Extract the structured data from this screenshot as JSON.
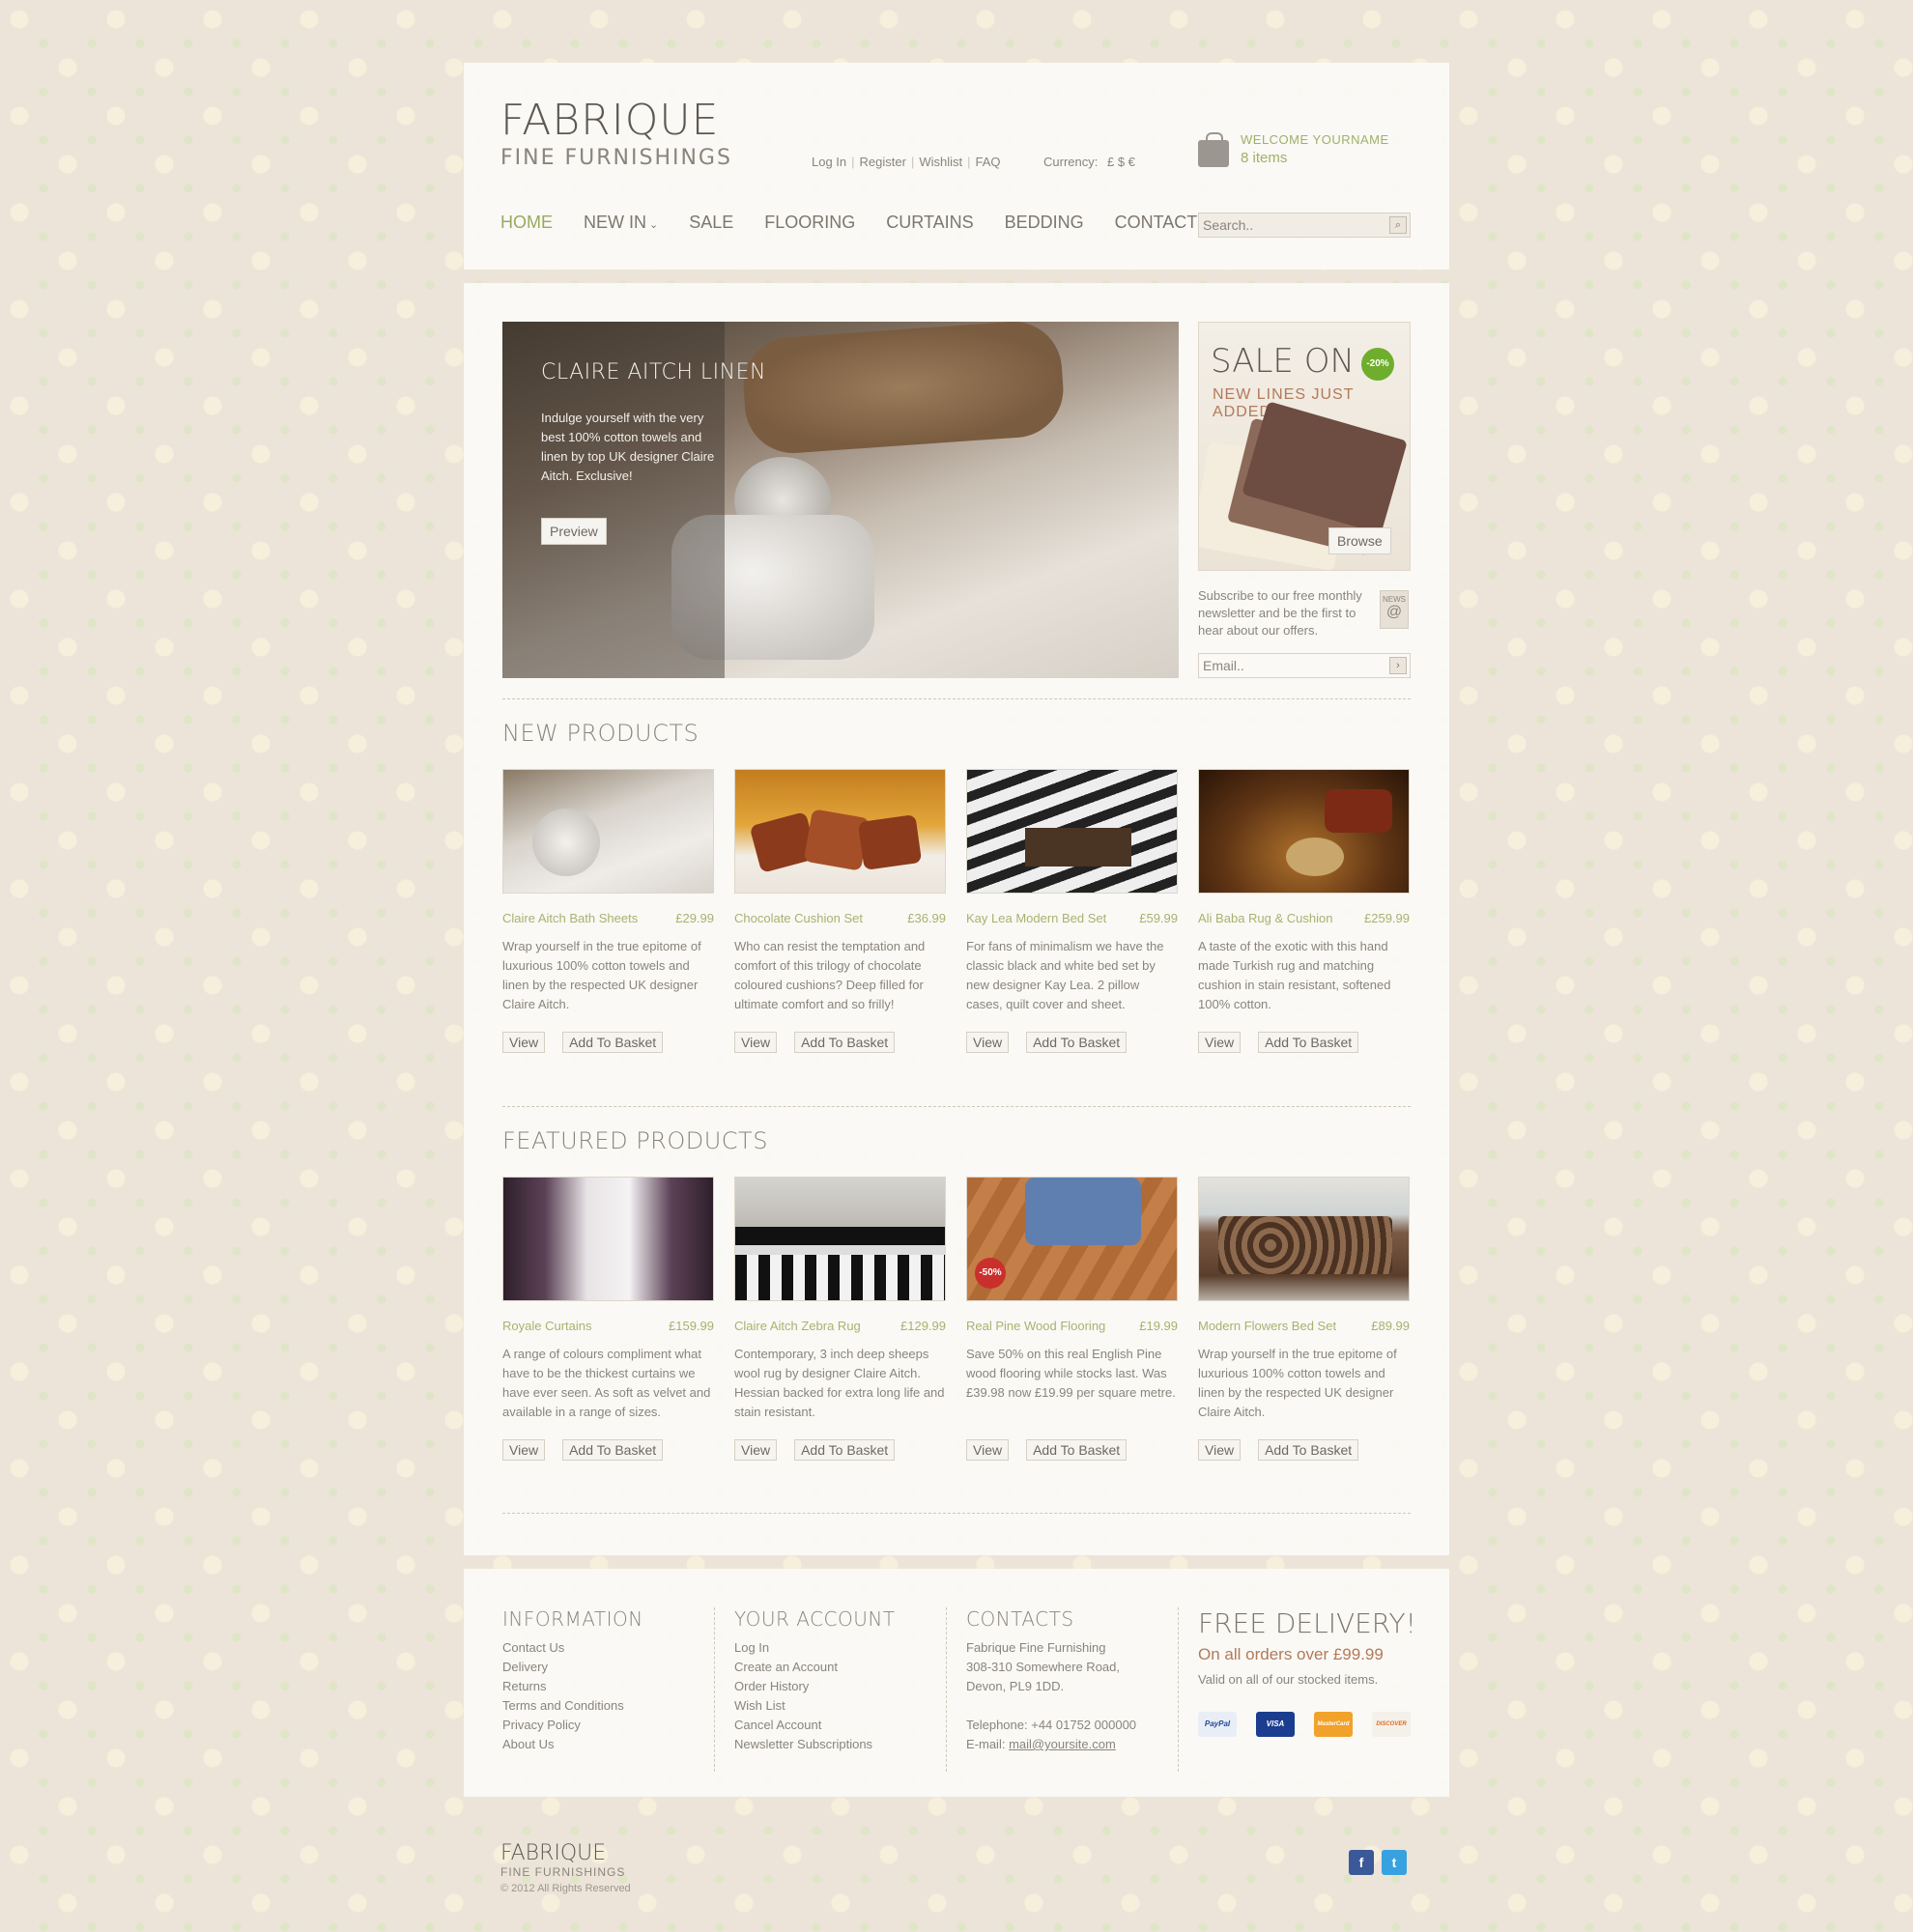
{
  "header": {
    "logo_main": "FABRIQUE",
    "logo_sub": "FINE FURNISHINGS",
    "top_links": [
      "Log In",
      "Register",
      "Wishlist",
      "FAQ"
    ],
    "currency_label": "Currency:",
    "currency_options": "£ $ €",
    "welcome": "WELCOME YOURNAME",
    "items": "8 items",
    "nav": [
      "HOME",
      "NEW IN",
      "SALE",
      "FLOORING",
      "CURTAINS",
      "BEDDING",
      "CONTACT US"
    ],
    "search_placeholder": "Search.."
  },
  "hero": {
    "title": "CLAIRE AITCH LINEN",
    "text": "Indulge yourself with the very best 100% cotton towels and linen by top UK designer Claire Aitch. Exclusive!",
    "button": "Preview"
  },
  "sale": {
    "title": "SALE ON",
    "badge": "-20%",
    "subtitle": "NEW LINES JUST ADDED!",
    "button": "Browse"
  },
  "newsletter": {
    "text": "Subscribe to our free monthly newsletter and be the first to hear about our offers.",
    "icon_label": "NEWS",
    "email_placeholder": "Email.."
  },
  "new_products": {
    "title": "NEW PRODUCTS",
    "items": [
      {
        "name": "Claire Aitch Bath Sheets",
        "price": "£29.99",
        "desc": "Wrap yourself in the true epitome of luxurious 100% cotton towels and linen by the respected UK designer Claire Aitch."
      },
      {
        "name": "Chocolate Cushion Set",
        "price": "£36.99",
        "desc": "Who can resist the temptation and comfort of this trilogy of chocolate coloured cushions? Deep filled for ultimate comfort and so frilly!"
      },
      {
        "name": "Kay Lea Modern Bed Set",
        "price": "£59.99",
        "desc": "For fans of minimalism we have the classic black and white bed set by new designer Kay Lea. 2 pillow cases, quilt cover and sheet."
      },
      {
        "name": "Ali Baba Rug & Cushion",
        "price": "£259.99",
        "desc": "A  taste of the exotic with this hand made Turkish rug and matching cushion in stain resistant, softened 100% cotton."
      }
    ]
  },
  "featured_products": {
    "title": "FEATURED PRODUCTS",
    "items": [
      {
        "name": "Royale Curtains",
        "price": "£159.99",
        "desc": "A range of colours compliment what have to be the thickest curtains we have ever seen. As soft as velvet and available in a range of sizes."
      },
      {
        "name": "Claire Aitch Zebra Rug",
        "price": "£129.99",
        "desc": "Contemporary, 3 inch deep sheeps wool rug by designer Claire Aitch. Hessian backed for extra long life and stain resistant."
      },
      {
        "name": "Real Pine Wood Flooring",
        "price": "£19.99",
        "desc": "Save 50% on this real English Pine wood flooring while stocks last. Was £39.98 now £19.99 per square metre.",
        "badge": "-50%"
      },
      {
        "name": "Modern Flowers Bed Set",
        "price": "£89.99",
        "desc": "Wrap yourself in the true epitome of luxurious 100% cotton towels and linen by the respected UK designer Claire Aitch."
      }
    ]
  },
  "buttons": {
    "view": "View",
    "add": "Add To Basket"
  },
  "footer": {
    "information": {
      "title": "INFORMATION",
      "links": [
        "Contact Us",
        "Delivery",
        "Returns",
        "Terms and Conditions",
        "Privacy Policy",
        "About Us"
      ]
    },
    "account": {
      "title": "YOUR ACCOUNT",
      "links": [
        "Log In",
        "Create an Account",
        "Order History",
        "Wish List",
        "Cancel Account",
        "Newsletter Subscriptions"
      ]
    },
    "contacts": {
      "title": "CONTACTS",
      "lines": [
        "Fabrique Fine Furnishing",
        "308-310 Somewhere Road,",
        "Devon,  PL9 1DD.",
        "",
        "Telephone: +44 01752 000000"
      ],
      "email_label": "E-mail:",
      "email": "mail@yoursite.com"
    },
    "delivery": {
      "title": "FREE DELIVERY!",
      "subtitle": "On all orders over £99.99",
      "note": "Valid on all of our stocked items.",
      "cards": [
        "PayPal",
        "VISA",
        "MasterCard",
        "DISCOVER"
      ]
    }
  },
  "bottom": {
    "logo_main": "FABRIQUE",
    "logo_sub": "FINE FURNISHINGS",
    "copyright": "© 2012 All Rights Reserved",
    "social": [
      "f",
      "t"
    ]
  },
  "colors": {
    "accent_green": "#98a960",
    "accent_rust": "#b27a5a",
    "sale_badge": "#6fae2d",
    "discount_badge": "#c9302c"
  }
}
